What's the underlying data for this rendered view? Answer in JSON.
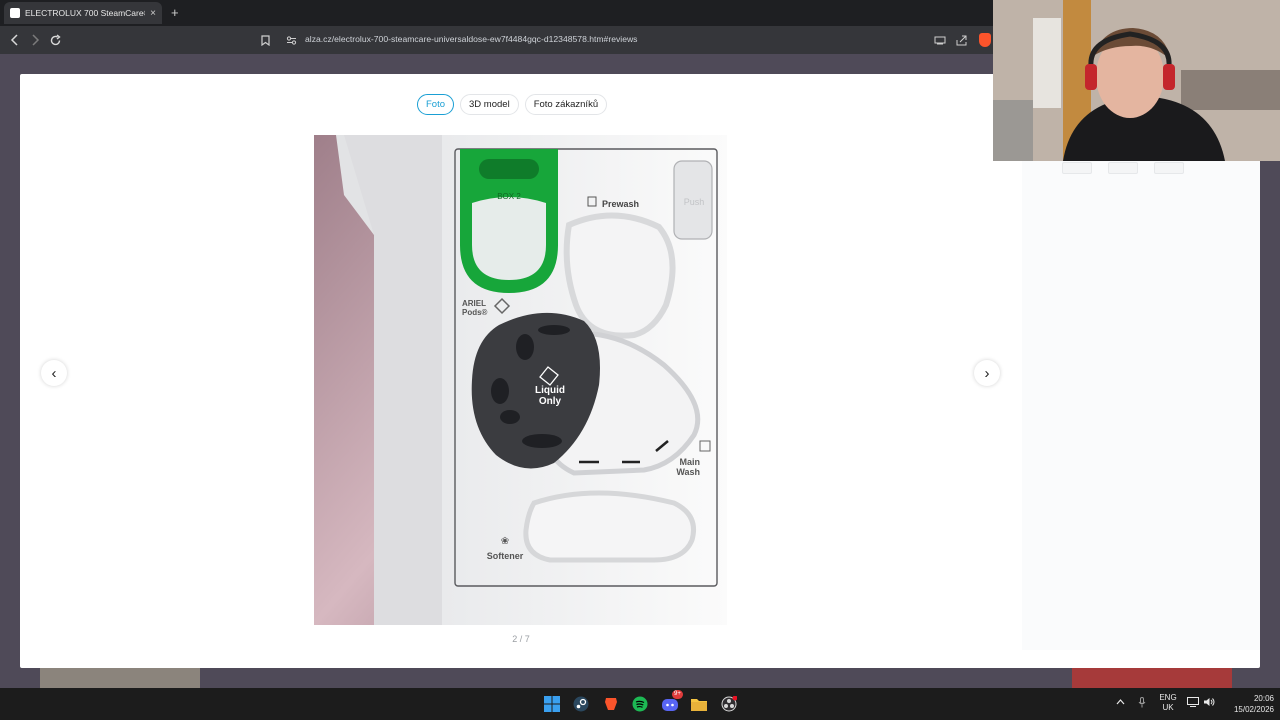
{
  "browser": {
    "tab_title": "ELECTROLUX 700 SteamCare® U",
    "tab_close": "×",
    "new_tab": "+",
    "url": "alza.cz/electrolux-700-steamcare-universaldose-ew7f4484gqc-d12348578.htm#reviews"
  },
  "gallery": {
    "tabs": [
      {
        "label": "Foto",
        "active": true
      },
      {
        "label": "3D model",
        "active": false
      },
      {
        "label": "Foto zákazníků",
        "active": false
      }
    ],
    "counter": "2 / 7",
    "prev_glyph": "‹",
    "next_glyph": "›"
  },
  "product_image": {
    "labels": {
      "box_label": "BOX 2",
      "prewash": "Prewash",
      "push": "Push",
      "ariel_line1": "ARIEL",
      "ariel_line2": "Pods®",
      "liquid_line1": "Liquid",
      "liquid_line2": "Only",
      "main_line1": "Main",
      "main_line2": "Wash",
      "softener": "Softener"
    },
    "colors": {
      "green_accent": "#17a63a",
      "cap_dark": "#3b3c40",
      "wall_pink": "#c9a7b0"
    }
  },
  "taskbar": {
    "lang_line1": "ENG",
    "lang_line2": "UK",
    "time": "20:06",
    "date": "15/02/2026",
    "discord_badge": "9+"
  },
  "colors": {
    "accent": "#1a9fd4",
    "modal_bg": "#ffffff",
    "taskbar_bg": "#1c1c1c"
  }
}
